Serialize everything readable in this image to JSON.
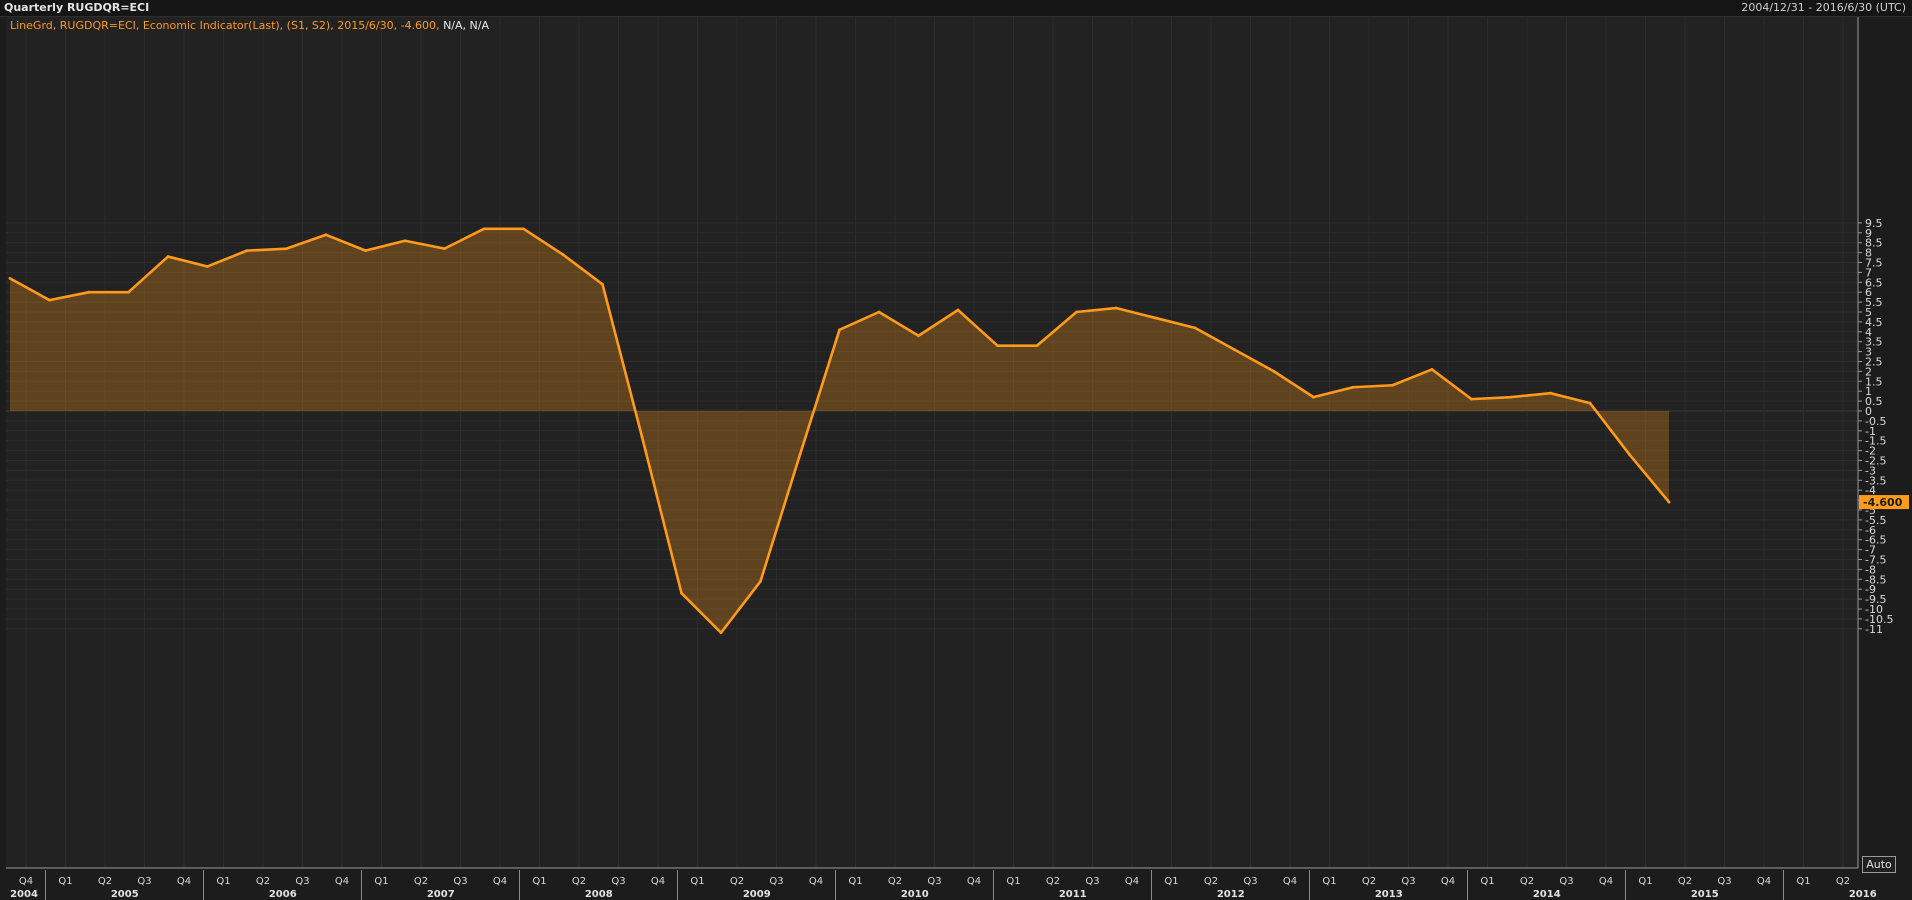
{
  "header": {
    "title": "Quarterly RUGDQR=ECI",
    "date_range": "2004/12/31 - 2016/6/30 (UTC)"
  },
  "legend": {
    "text": "LineGrd, RUGDQR=ECI, Economic Indicator(Last), (S1, S2), 2015/6/30, -4.600,",
    "na_text": "N/A, N/A"
  },
  "controls": {
    "auto_label": "Auto"
  },
  "colors": {
    "line": "#ff9a1a",
    "fill": "#ff9a1a",
    "last_value_badge": "#ff9a1a",
    "background": "#1c1c1c",
    "grid": "#2c2c2c"
  },
  "chart_data": {
    "type": "area",
    "series": [
      {
        "x": [
          "2004-Q4",
          "2005-Q1",
          "2005-Q2",
          "2005-Q3",
          "2005-Q4",
          "2006-Q1",
          "2006-Q2",
          "2006-Q3",
          "2006-Q4",
          "2007-Q1",
          "2007-Q2",
          "2007-Q3",
          "2007-Q4",
          "2008-Q1",
          "2008-Q2",
          "2008-Q3",
          "2008-Q4",
          "2009-Q1",
          "2009-Q2",
          "2009-Q3",
          "2009-Q4",
          "2010-Q1",
          "2010-Q2",
          "2010-Q3",
          "2010-Q4",
          "2011-Q1",
          "2011-Q2",
          "2011-Q3",
          "2011-Q4",
          "2012-Q1",
          "2012-Q2",
          "2012-Q3",
          "2012-Q4",
          "2013-Q1",
          "2013-Q2",
          "2013-Q3",
          "2013-Q4",
          "2014-Q1",
          "2014-Q2",
          "2014-Q3",
          "2014-Q4",
          "2015-Q1",
          "2015-Q2"
        ],
        "values": [
          6.7,
          5.6,
          6.0,
          6.0,
          7.8,
          7.3,
          8.1,
          8.2,
          8.9,
          8.1,
          8.6,
          8.2,
          9.2,
          9.2,
          7.9,
          6.4,
          -1.3,
          -9.2,
          -11.2,
          -8.6,
          -2.2,
          4.1,
          5.0,
          3.8,
          5.1,
          3.3,
          3.3,
          5.0,
          5.2,
          4.7,
          4.2,
          3.1,
          2.0,
          0.7,
          1.2,
          1.3,
          2.1,
          0.6,
          0.7,
          0.9,
          0.4,
          -2.2,
          -4.6
        ]
      }
    ],
    "last_value_label": "-4.600",
    "ylim": [
      -11.3,
      9.7
    ],
    "y_ticks": [
      "9.5",
      "9",
      "8.5",
      "8",
      "7.5",
      "7",
      "6.5",
      "6",
      "5.5",
      "5",
      "4.5",
      "4",
      "3.5",
      "3",
      "2.5",
      "2",
      "1.5",
      "1",
      "0.5",
      "0",
      "-0.5",
      "-1",
      "-1.5",
      "-2",
      "-2.5",
      "-3",
      "-3.5",
      "-4",
      "-4.5",
      "-5",
      "-5.5",
      "-6",
      "-6.5",
      "-7",
      "-7.5",
      "-8",
      "-8.5",
      "-9",
      "-9.5",
      "-10",
      "-10.5",
      "-11"
    ],
    "x_quarter_labels": [
      "Q4",
      "Q1",
      "Q2",
      "Q3",
      "Q4",
      "Q1",
      "Q2",
      "Q3",
      "Q4",
      "Q1",
      "Q2",
      "Q3",
      "Q4",
      "Q1",
      "Q2",
      "Q3",
      "Q4",
      "Q1",
      "Q2",
      "Q3",
      "Q4",
      "Q1",
      "Q2",
      "Q3",
      "Q4",
      "Q1",
      "Q2",
      "Q3",
      "Q4",
      "Q1",
      "Q2",
      "Q3",
      "Q4",
      "Q1",
      "Q2",
      "Q3",
      "Q4",
      "Q1",
      "Q2",
      "Q3",
      "Q4",
      "Q1",
      "Q2",
      "Q3",
      "Q4",
      "Q1",
      "Q2"
    ],
    "x_year_labels": [
      "2004",
      "2005",
      "2006",
      "2007",
      "2008",
      "2009",
      "2010",
      "2011",
      "2012",
      "2013",
      "2014",
      "2015",
      "2016"
    ],
    "grid": true
  }
}
